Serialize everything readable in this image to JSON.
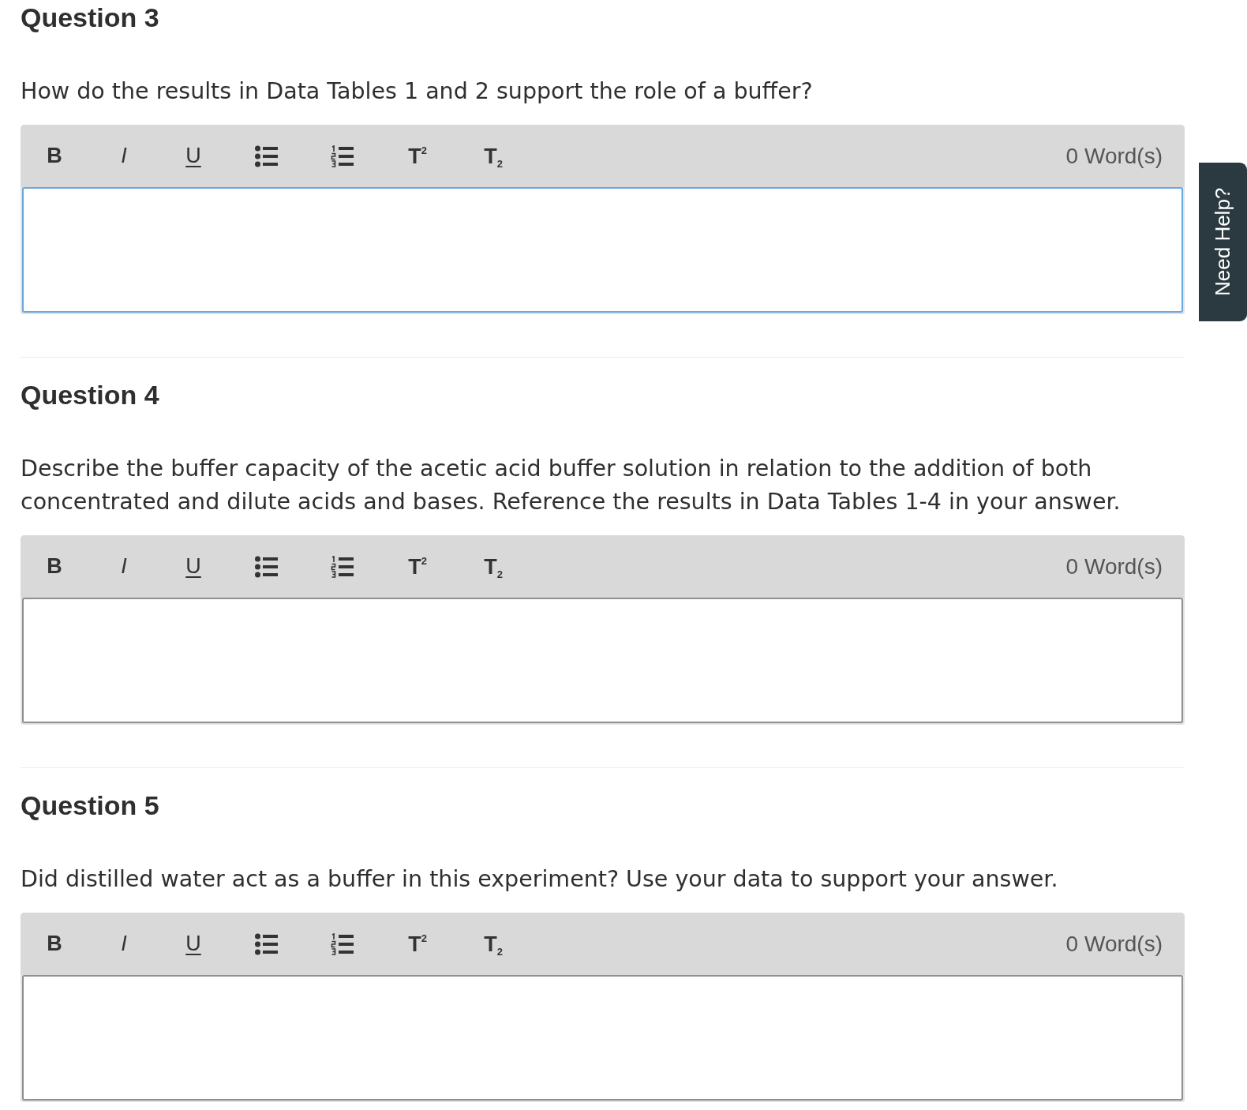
{
  "questions": [
    {
      "heading": "Question 3",
      "prompt": "How do the results in Data Tables 1 and 2 support the role of a buffer?",
      "editor": {
        "tools": [
          {
            "kind": "bold",
            "label": "B"
          },
          {
            "kind": "italic",
            "label": "I"
          },
          {
            "kind": "underline",
            "label": "U"
          },
          {
            "kind": "bullet-list"
          },
          {
            "kind": "numbered-list"
          },
          {
            "kind": "superscript",
            "label": "T$^{2}$"
          },
          {
            "kind": "subscript",
            "label": "T$_{2}$"
          }
        ],
        "word_count": "0 Word(s)",
        "focused": true
      }
    },
    {
      "heading": "Question 4",
      "prompt": "Describe the buffer capacity of the acetic acid buffer solution in relation to the addition of both concentrated and dilute acids and bases. Reference the results in Data Tables 1-4 in your answer.",
      "editor": {
        "tools": [
          {
            "kind": "bold",
            "label": "B"
          },
          {
            "kind": "italic",
            "label": "I"
          },
          {
            "kind": "underline",
            "label": "U"
          },
          {
            "kind": "bullet-list"
          },
          {
            "kind": "numbered-list"
          },
          {
            "kind": "superscript",
            "label": "T$^{2}$"
          },
          {
            "kind": "subscript",
            "label": "T$_{2}$"
          }
        ],
        "word_count": "0 Word(s)",
        "focused": false
      }
    },
    {
      "heading": "Question 5",
      "prompt": "Did distilled water act as a buffer in this experiment? Use your data to support your answer.",
      "editor": {
        "tools": [
          {
            "kind": "bold",
            "label": "B"
          },
          {
            "kind": "italic",
            "label": "I"
          },
          {
            "kind": "underline",
            "label": "U"
          },
          {
            "kind": "bullet-list"
          },
          {
            "kind": "numbered-list"
          },
          {
            "kind": "superscript",
            "label": "T$^{2}$"
          },
          {
            "kind": "subscript",
            "label": "T$_{2}$"
          }
        ],
        "word_count": "0 Word(s)",
        "focused": false
      }
    }
  ],
  "help_tab": {
    "label": "Need Help?"
  }
}
